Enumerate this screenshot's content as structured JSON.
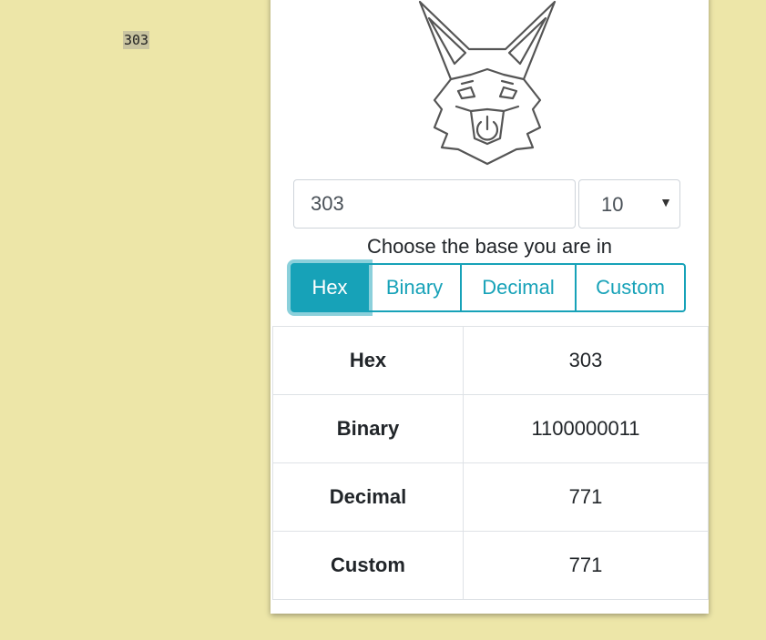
{
  "code_snippet": "303",
  "converter": {
    "input_value": "303",
    "base_select": "10",
    "hint": "Choose the base you are in",
    "buttons": [
      {
        "label": "Hex",
        "active": true
      },
      {
        "label": "Binary",
        "active": false
      },
      {
        "label": "Decimal",
        "active": false
      },
      {
        "label": "Custom",
        "active": false
      }
    ],
    "results": [
      {
        "label": "Hex",
        "value": "303"
      },
      {
        "label": "Binary",
        "value": "1100000011"
      },
      {
        "label": "Decimal",
        "value": "771"
      },
      {
        "label": "Custom",
        "value": "771"
      }
    ]
  },
  "colors": {
    "page_bg": "#ede6a8",
    "accent": "#17a2b8"
  },
  "icons": {
    "logo": "fox-power-logo",
    "select": "caret-down-icon"
  }
}
